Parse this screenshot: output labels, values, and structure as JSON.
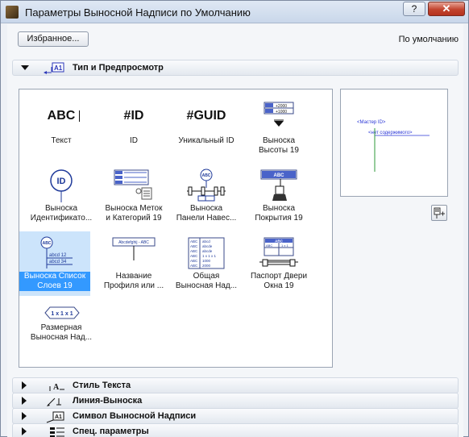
{
  "window": {
    "title": "Параметры Выносной Надписи по Умолчанию",
    "help_label": "?",
    "close_label": "✕"
  },
  "toolbar": {
    "favorites_label": "Избранное...",
    "default_label": "По умолчанию"
  },
  "panels": {
    "type_preview": "Тип и Предпросмотр",
    "text_style": "Стиль Текста",
    "leader_line": "Линия-Выноска",
    "label_symbol": "Символ Выносной Надписи",
    "special_params": "Спец. параметры"
  },
  "tiles": [
    {
      "label_1": "Текст",
      "label_2": "",
      "glyph": "ABC",
      "icon": "text-icon"
    },
    {
      "label_1": "ID",
      "label_2": "",
      "glyph": "#ID",
      "icon": "id-icon"
    },
    {
      "label_1": "Уникальный ID",
      "label_2": "",
      "glyph": "#GUID",
      "icon": "guid-icon"
    },
    {
      "label_1": "Выноска",
      "label_2": "Высоты 19",
      "icon": "elevation-label-icon"
    },
    {
      "label_1": "Выноска",
      "label_2": "Идентификато...",
      "glyph": "ID",
      "icon": "identifier-label-icon"
    },
    {
      "label_1": "Выноска Меток",
      "label_2": "и Категорий 19",
      "icon": "tags-categories-icon"
    },
    {
      "label_1": "Выноска",
      "label_2": "Панели Навес...",
      "glyph": "ABC",
      "icon": "curtain-panel-icon"
    },
    {
      "label_1": "Выноска",
      "label_2": "Покрытия 19",
      "glyph": "ABC",
      "icon": "cover-label-icon"
    },
    {
      "label_1": "Выноска Список",
      "label_2": "Слоев 19",
      "glyph": "ABC",
      "icon": "layer-list-icon"
    },
    {
      "label_1": "Название",
      "label_2": "Профиля или ...",
      "glyph": "Abcdefghij - ABC",
      "icon": "profile-name-icon"
    },
    {
      "label_1": "Общая",
      "label_2": "Выносная Над...",
      "icon": "general-label-icon"
    },
    {
      "label_1": "Паспорт Двери",
      "label_2": "Окна 19",
      "glyph": "ABC",
      "icon": "door-window-icon"
    },
    {
      "label_1": "Размерная",
      "label_2": "Выносная Над...",
      "glyph": "1 x 1 x 1",
      "icon": "dimension-label-icon"
    }
  ],
  "preview": {
    "master_id": "<Мастер ID>",
    "no_content": "<нет содержимого>"
  },
  "colors": {
    "selection": "#3399ff",
    "preview_text": "#2a36d6",
    "preview_line": "#2e9a3a"
  }
}
